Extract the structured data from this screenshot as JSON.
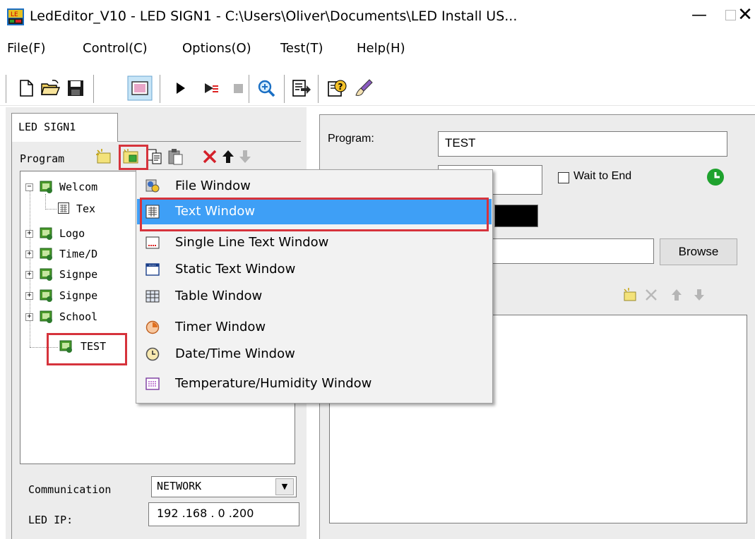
{
  "window": {
    "title": "LedEditor_V10 - LED SIGN1 - C:\\Users\\Oliver\\Documents\\LED Install US...",
    "minimize_glyph": "—",
    "close_glyph": "✕"
  },
  "menu": [
    "File(F)",
    "Control(C)",
    "Options(O)",
    "Test(T)",
    "Help(H)"
  ],
  "toolbar": {
    "icons": [
      "new-file-icon",
      "open-folder-icon",
      "save-icon",
      "screen-icon",
      "play-icon",
      "play-step-icon",
      "stop-icon",
      "zoom-icon",
      "export-icon",
      "help-icon",
      "brush-icon"
    ]
  },
  "left": {
    "tab": "LED SIGN1",
    "program_label": "Program",
    "tree": [
      {
        "label": "Welcom",
        "expand": "−"
      },
      {
        "label": "Tex",
        "type": "text"
      },
      {
        "label": "Logo",
        "expand": "+"
      },
      {
        "label": "Time/D",
        "expand": "+"
      },
      {
        "label": "Signpe",
        "expand": "+"
      },
      {
        "label": "Signpe",
        "expand": "+"
      },
      {
        "label": "School",
        "expand": "+"
      },
      {
        "label": "TEST"
      }
    ],
    "communication_label": "Communication",
    "communication_value": "NETWORK",
    "dropdown_glyph": "▼",
    "ip_label": "LED IP:",
    "ip_value": "192 .168 . 0  .200"
  },
  "right": {
    "program_label": "Program:",
    "program_value": "TEST",
    "wait_label": "Wait to End",
    "browse_label": "Browse"
  },
  "context_menu": [
    {
      "label": "File Window",
      "icon": "file-window-icon"
    },
    {
      "label": "Text Window",
      "icon": "text-window-icon",
      "selected": true
    },
    {
      "label": "Single Line Text Window",
      "icon": "single-line-icon"
    },
    {
      "label": "Static Text Window",
      "icon": "static-text-icon"
    },
    {
      "label": "Table Window",
      "icon": "table-icon"
    },
    {
      "label": "Timer Window",
      "icon": "timer-icon"
    },
    {
      "label": "Date/Time Window",
      "icon": "datetime-icon"
    },
    {
      "label": "Temperature/Humidity Window",
      "icon": "temperature-icon"
    }
  ],
  "colors": {
    "highlight": "#3e9ff6",
    "annotation_red": "#d6333c",
    "clock_green": "#1fa22e"
  }
}
